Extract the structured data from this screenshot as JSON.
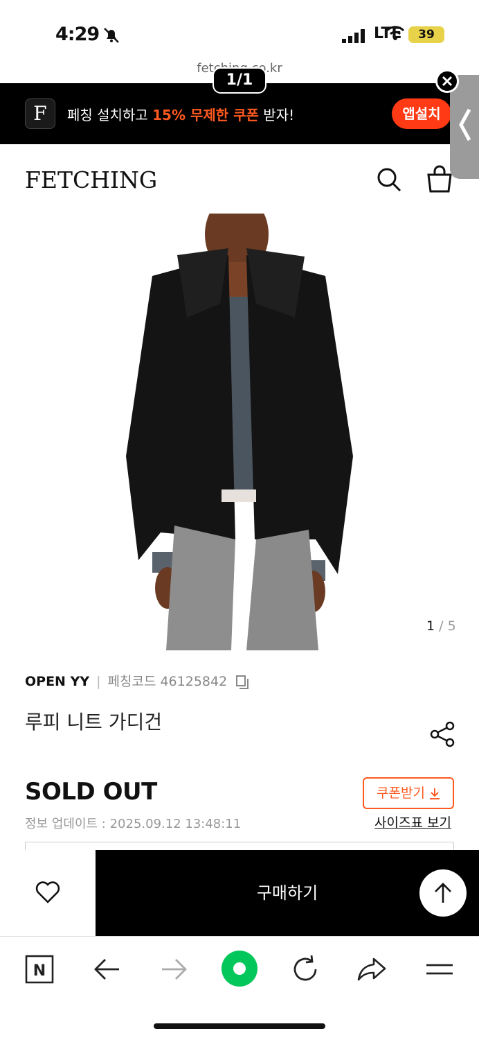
{
  "status_bar": {
    "time": "4:29",
    "network": "LTE",
    "battery": "39"
  },
  "browser": {
    "url": "fetching.co.kr",
    "page_counter": "1/1"
  },
  "app_banner": {
    "logo_letter": "F",
    "text_prefix": "페칭 설치하고 ",
    "text_highlight": "15% 무제한 쿠폰",
    "text_suffix": " 받자!",
    "install_label": "앱설치"
  },
  "header": {
    "logo": "FETCHING"
  },
  "product": {
    "image_counter_current": "1",
    "image_counter_total": "/ 5",
    "brand": "OPEN YY",
    "code_label": "페칭코드 46125842",
    "name": "루피 니트 가디건",
    "status": "SOLD OUT",
    "updated": "정보 업데이트 : 2025.09.12 13:48:11",
    "coupon_label": "쿠폰받기",
    "size_chart_label": "사이즈표 보기"
  },
  "actions": {
    "buy_label": "구매하기"
  },
  "colors": {
    "accent": "#ff5a1f",
    "install": "#ff3a14",
    "naver_green": "#03c75a"
  }
}
